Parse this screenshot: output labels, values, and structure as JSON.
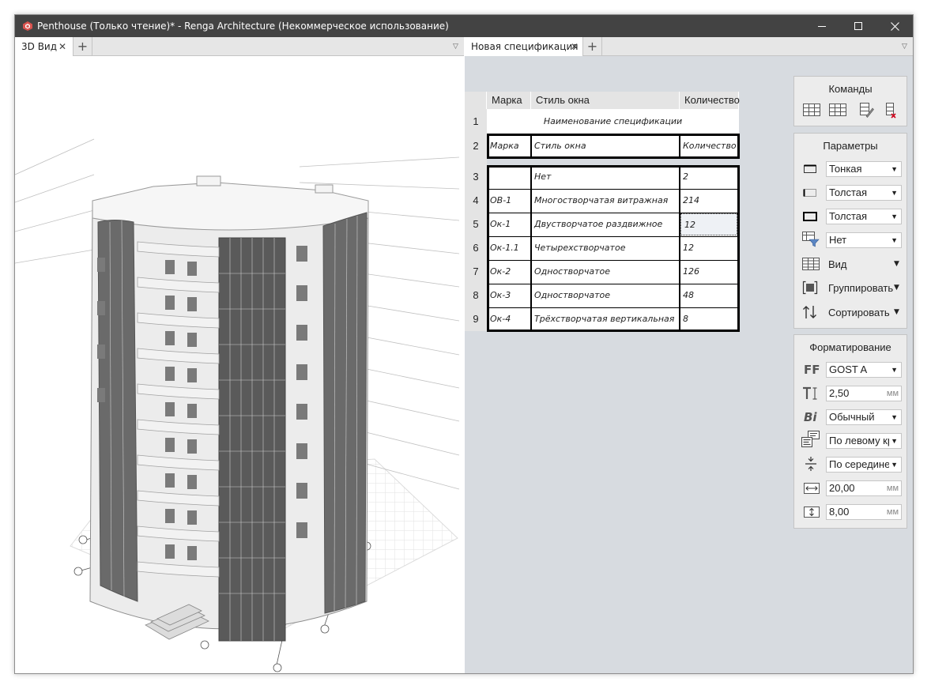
{
  "window": {
    "title": "Penthouse (Только чтение)* - Renga Architecture (Некоммерческое использование)",
    "controls": {
      "minimize_icon": "minimize-icon",
      "maximize_icon": "maximize-icon",
      "close_icon": "close-icon"
    }
  },
  "left_pane": {
    "tabs": [
      {
        "label": "3D Вид",
        "active": true
      }
    ],
    "add_tab_icon": "plus-icon",
    "menu_icon": "triangle-down-icon"
  },
  "right_pane": {
    "tabs": [
      {
        "label": "Новая спецификация",
        "active": true
      }
    ],
    "add_tab_icon": "plus-icon",
    "menu_icon": "triangle-down-icon"
  },
  "spec_table": {
    "columns": [
      "Марка",
      "Стиль окна",
      "Количество"
    ],
    "title_row": {
      "num": "1",
      "text": "Наименование спецификации"
    },
    "header_row": {
      "num": "2",
      "cells": [
        "Марка",
        "Стиль окна",
        "Количество"
      ]
    },
    "rows": [
      {
        "num": "3",
        "mark": "",
        "style": "Нет",
        "qty": "2"
      },
      {
        "num": "4",
        "mark": "ОВ-1",
        "style": "Многостворчатая витражная",
        "qty": "214"
      },
      {
        "num": "5",
        "mark": "Ок-1",
        "style": "Двустворчатое раздвижное",
        "qty": "12"
      },
      {
        "num": "6",
        "mark": "Ок-1.1",
        "style": "Четырехстворчатое",
        "qty": "12"
      },
      {
        "num": "7",
        "mark": "Ок-2",
        "style": "Одностворчатое",
        "qty": "126"
      },
      {
        "num": "8",
        "mark": "Ок-3",
        "style": "Одностворчатое",
        "qty": "48"
      },
      {
        "num": "9",
        "mark": "Ок-4",
        "style": "Трёхстворчатая вертикальная",
        "qty": "8"
      }
    ]
  },
  "commands_panel": {
    "title": "Команды",
    "icons": [
      "insert-row-above-icon",
      "insert-row-below-icon",
      "edit-table-icon",
      "delete-row-icon"
    ]
  },
  "params_panel": {
    "title": "Параметры",
    "outer_line": "Тонкая",
    "inner_line": "Толстая",
    "header_line": "Толстая",
    "filter": "Нет",
    "view_label": "Вид",
    "group_label": "Группировать",
    "sort_label": "Сортировать"
  },
  "format_panel": {
    "title": "Форматирование",
    "font": "GOST A",
    "font_icon_text": "FF",
    "font_size": "2,50",
    "font_size_unit": "мм",
    "style_icon_text": "Bi",
    "style": "Обычный",
    "h_align": "По левому кр",
    "v_align": "По середине",
    "width": "20,00",
    "width_unit": "мм",
    "height": "8,00",
    "height_unit": "мм"
  },
  "colors": {
    "titlebar": "#434343",
    "spec_background": "#d7dbe0",
    "panel_background": "#ececec",
    "building_wall": "#ececec",
    "glazing": "#555555"
  }
}
